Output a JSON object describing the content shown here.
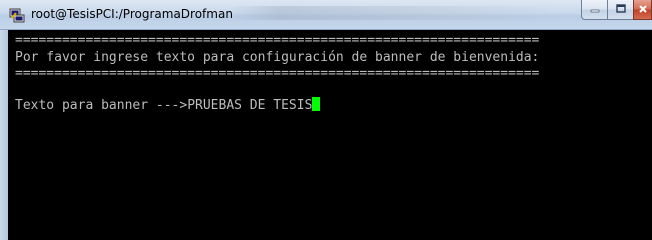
{
  "window": {
    "title": "root@TesisPCI:/ProgramaDrofman",
    "icon": "putty-terminal-icon",
    "buttons": {
      "minimize": "minimize-icon",
      "maximize": "maximize-icon",
      "close": "close-icon"
    }
  },
  "terminal": {
    "separator_top": "===================================================================",
    "prompt_heading": "Por favor ingrese texto para configuración de banner de bienvenida:",
    "separator_bottom": "===================================================================",
    "input_label": "Texto para banner --->",
    "input_value": "PRUEBAS DE TESIS"
  },
  "colors": {
    "terminal_bg": "#000000",
    "terminal_fg": "#bcbcbc",
    "cursor": "#00ff00"
  }
}
